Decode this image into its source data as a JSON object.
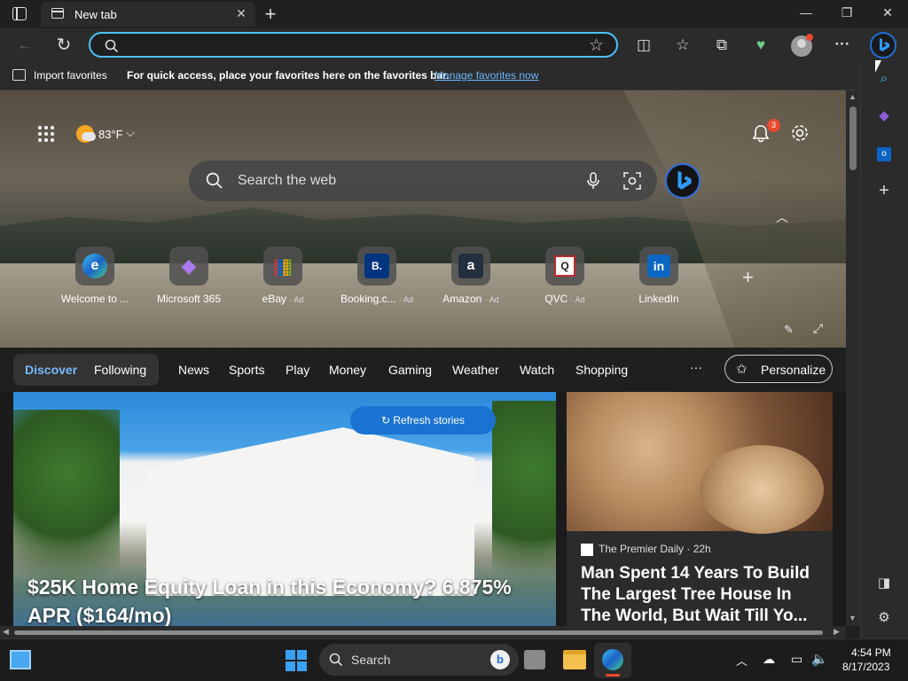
{
  "window": {
    "tab_title": "New tab",
    "tab_close": "✕",
    "new_tab": "+",
    "minimize": "—",
    "restore": "❐",
    "close": "✕"
  },
  "toolbar": {
    "back": "←",
    "refresh": "↻",
    "address_value": "",
    "favorite_star": "☆",
    "split_screen": "◫",
    "favorites": "☆",
    "collections": "⧉",
    "performance": "♥",
    "more": "···"
  },
  "favorites_bar": {
    "import_label": "Import favorites",
    "message": "For quick access, place your favorites here on the favorites bar.",
    "manage_link": "Manage favorites now"
  },
  "hero": {
    "weather_temp": "83°F",
    "notifications_count": "3",
    "search_placeholder": "Search the web"
  },
  "quick_links": [
    {
      "label": "Welcome to ...",
      "ad": "",
      "glyph": "e",
      "color": "#1e8fd8"
    },
    {
      "label": "Microsoft 365",
      "ad": "",
      "glyph": "◆",
      "color": "#8a5cd6"
    },
    {
      "label": "eBay",
      "ad": "· Ad",
      "glyph": "▦",
      "color": "#e53238"
    },
    {
      "label": "Booking.c...",
      "ad": "· Ad",
      "glyph": "B.",
      "color": "#003580"
    },
    {
      "label": "Amazon",
      "ad": "· Ad",
      "glyph": "a",
      "color": "#232f3e"
    },
    {
      "label": "QVC",
      "ad": "· Ad",
      "glyph": "Q",
      "color": "#ffffff"
    },
    {
      "label": "LinkedIn",
      "ad": "",
      "glyph": "in",
      "color": "#0a66c2"
    }
  ],
  "nav": {
    "discover": "Discover",
    "following": "Following",
    "items": [
      "News",
      "Sports",
      "Play",
      "Money",
      "Gaming",
      "Weather",
      "Watch",
      "Shopping"
    ],
    "more": "···",
    "personalize": "Personalize"
  },
  "feed": {
    "refresh_label": "Refresh stories",
    "card1_headline": "$25K Home Equity Loan in this Economy? 6.875% APR ($164/mo)",
    "card2_source": "The Premier Daily · 22h",
    "card2_headline": "Man Spent 14 Years To Build The Largest Tree House In The World, But Wait Till Yo..."
  },
  "taskbar": {
    "search_label": "Search",
    "time": "4:54 PM",
    "date": "8/17/2023"
  },
  "colors": {
    "accent": "#4cc2ff",
    "link": "#6cb6ff",
    "refresh_button": "#1a73d1",
    "notification_badge": "#e8492f"
  }
}
